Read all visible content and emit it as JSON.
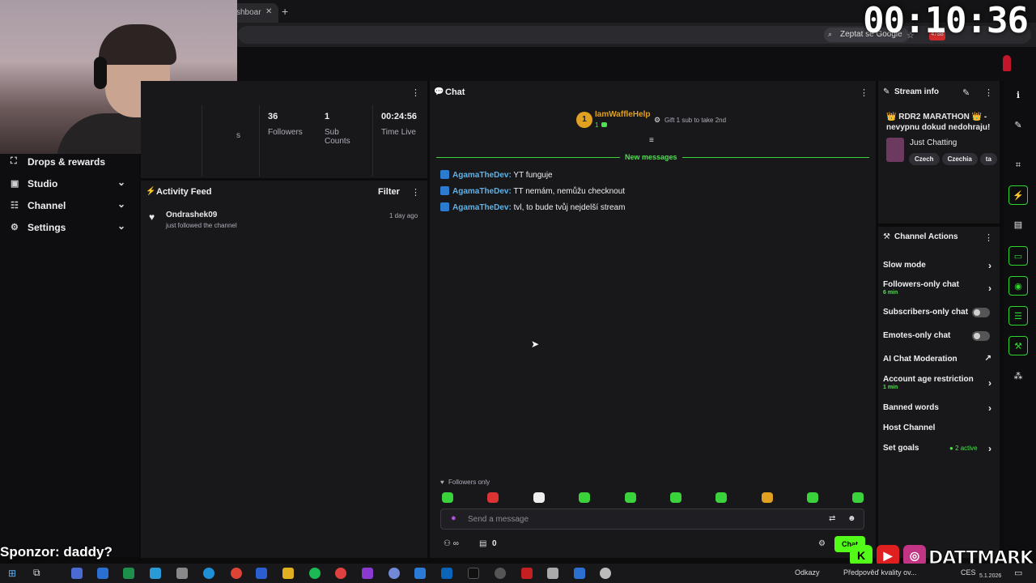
{
  "overlay": {
    "timer": "00:10:36",
    "sponsor_text": "Sponzor: daddy?",
    "brand_name": "DATTMARK",
    "social_k": "K"
  },
  "browser": {
    "tab_label": "shboar",
    "ask_google": "Zeptat se Google",
    "badge_count": "4788"
  },
  "sidebar": {
    "items": [
      {
        "label": "Drops & rewards"
      },
      {
        "label": "Studio"
      },
      {
        "label": "Channel"
      },
      {
        "label": "Settings"
      }
    ]
  },
  "stats": {
    "partial_label": "s",
    "items": [
      {
        "value": "36",
        "label": "Followers"
      },
      {
        "value": "1",
        "label": "Sub Counts"
      },
      {
        "value": "00:24:56",
        "label": "Time Live"
      }
    ]
  },
  "activity_feed": {
    "title": "Activity Feed",
    "filter_label": "Filter",
    "events": [
      {
        "user": "Ondrashek09",
        "desc": "just followed the channel",
        "time": "1 day ago"
      }
    ]
  },
  "chat": {
    "title": "Chat",
    "top_gifter": {
      "rank": "1",
      "name": "IamWaffleHelp",
      "count": "1"
    },
    "gift_prompt": "Gift 1 sub to take 2nd",
    "new_messages_label": "New messages",
    "messages": [
      {
        "user": "AgamaTheDev:",
        "text": "YT funguje"
      },
      {
        "user": "AgamaTheDev:",
        "text": "TT nemám, nemůžu checknout"
      },
      {
        "user": "AgamaTheDev:",
        "text": "tvl, to bude tvůj nejdelší stream"
      }
    ],
    "mode_label": "Followers only",
    "input_placeholder": "Send a message",
    "viewer_count": "0",
    "send_label": "Chat"
  },
  "stream_info": {
    "title_label": "Stream info",
    "stream_title": "👑 RDR2 MARATHON 👑 - nevypnu dokud nedohraju!",
    "category": "Just Chatting",
    "tags": [
      "Czech",
      "Czechia",
      "ta"
    ]
  },
  "channel_actions": {
    "title": "Channel Actions",
    "items": [
      {
        "label": "Slow mode",
        "sub": ""
      },
      {
        "label": "Followers-only chat",
        "sub": "6 min"
      },
      {
        "label": "Subscribers-only chat",
        "sub": ""
      },
      {
        "label": "Emotes-only chat",
        "sub": ""
      },
      {
        "label": "AI Chat Moderation",
        "sub": ""
      },
      {
        "label": "Account age restriction",
        "sub": "1 min"
      },
      {
        "label": "Banned words",
        "sub": ""
      },
      {
        "label": "Host Channel",
        "sub": ""
      },
      {
        "label": "Set goals",
        "sub": ""
      }
    ],
    "goals_active": "2 active"
  },
  "taskbar": {
    "links_label": "Odkazy",
    "weather_text": "Předpověď kvality ov...",
    "lang": "CES",
    "date": "5.1.2026"
  },
  "colors": {
    "accent": "#53fc18",
    "panel": "#18181b",
    "background": "#0b0b0c",
    "username": "#5fb2e8"
  }
}
